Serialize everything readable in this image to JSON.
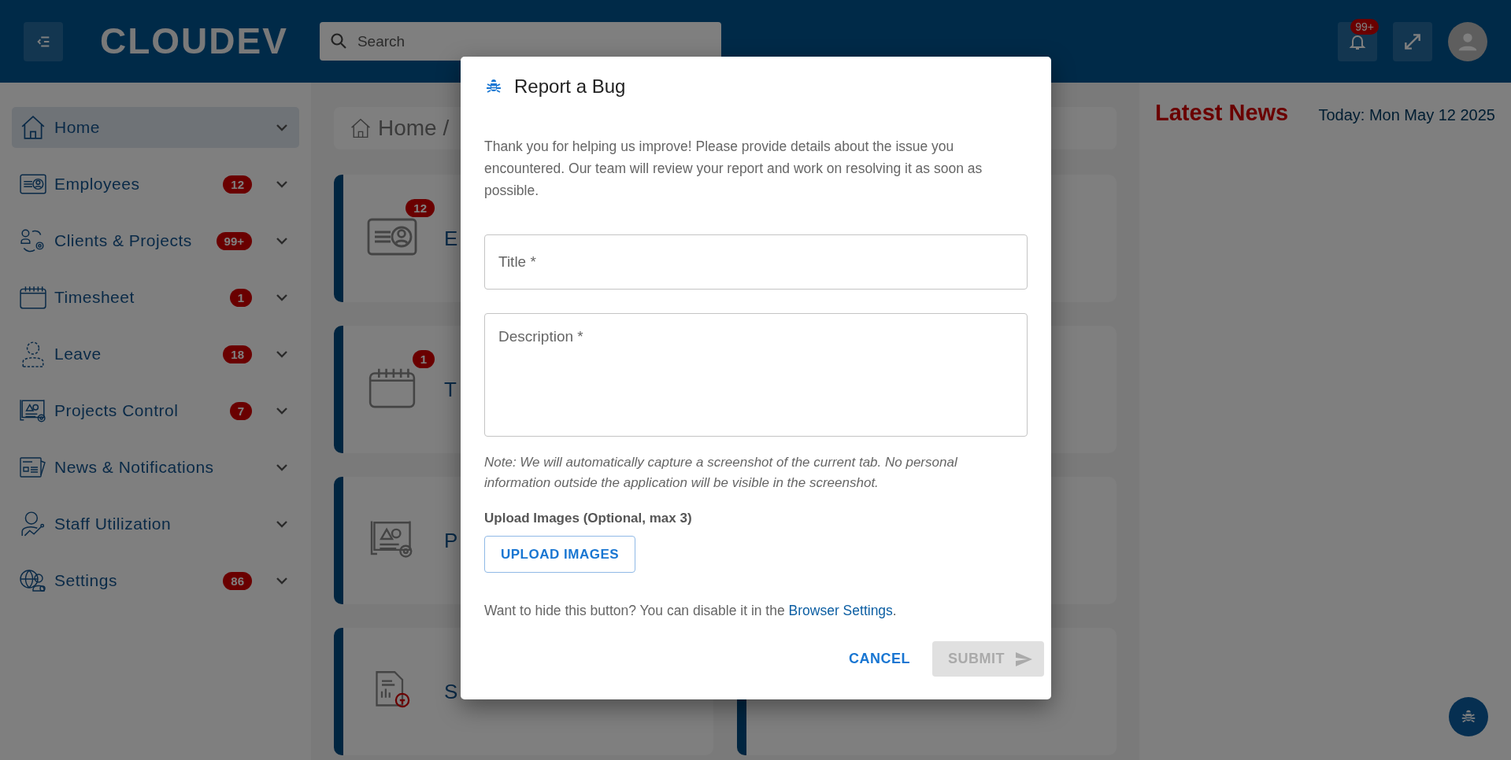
{
  "header": {
    "logo": "CLOUDEV",
    "search": {
      "placeholder": "Search"
    },
    "notification_badge": "99+"
  },
  "sidebar": {
    "items": [
      {
        "label": "Home",
        "kind": "home",
        "selected": true
      },
      {
        "label": "Employees",
        "kind": "id-card",
        "badge": "12",
        "selected": false
      },
      {
        "label": "Clients & Projects",
        "kind": "people-gear",
        "badge": "99+",
        "selected": false
      },
      {
        "label": "Timesheet",
        "kind": "calendar",
        "badge": "1",
        "selected": false
      },
      {
        "label": "Leave",
        "kind": "dashed-person",
        "badge": "18",
        "selected": false
      },
      {
        "label": "Projects Control",
        "kind": "blueprint",
        "badge": "7",
        "selected": false
      },
      {
        "label": "News & Notifications",
        "kind": "newspaper",
        "selected": false
      },
      {
        "label": "Staff Utilization",
        "kind": "person-chart",
        "selected": false
      },
      {
        "label": "Settings",
        "kind": "globe-people",
        "badge": "86",
        "selected": false
      }
    ]
  },
  "breadcrumb": "Home /",
  "cards": [
    {
      "kind": "id-card",
      "title": "E",
      "badge": "12"
    },
    {
      "kind": "covered"
    },
    {
      "kind": "calendar",
      "title": "T",
      "badge": "1"
    },
    {
      "kind": "covered"
    },
    {
      "kind": "blueprint",
      "title": "P"
    },
    {
      "kind": "covered"
    },
    {
      "kind": "report",
      "title": "S"
    },
    {
      "kind": "edge"
    }
  ],
  "news": {
    "title": "Latest News",
    "date": "Today: Mon May 12 2025"
  },
  "dialog": {
    "title": "Report a Bug",
    "intro": "Thank you for helping us improve! Please provide details about the issue you encountered. Our team will review your report and work on resolving it as soon as possible.",
    "fields": [
      {
        "kind": "line",
        "placeholder": "Title *"
      },
      {
        "kind": "area",
        "placeholder": "Description *"
      }
    ],
    "note": "Note: We will automatically capture a screenshot of the current tab. No personal information outside the application will be visible in the screenshot.",
    "upload_label": "Upload Images (Optional, max 3)",
    "upload_button": "UPLOAD IMAGES",
    "hide_note": {
      "text": "Want to hide this button? You can disable it in the",
      "link": "Browser Settings",
      "end": "."
    },
    "buttons": [
      {
        "label": "CANCEL",
        "kind": "text",
        "disabled": false
      },
      {
        "label": "SUBMIT",
        "kind": "send",
        "disabled": true
      }
    ]
  }
}
